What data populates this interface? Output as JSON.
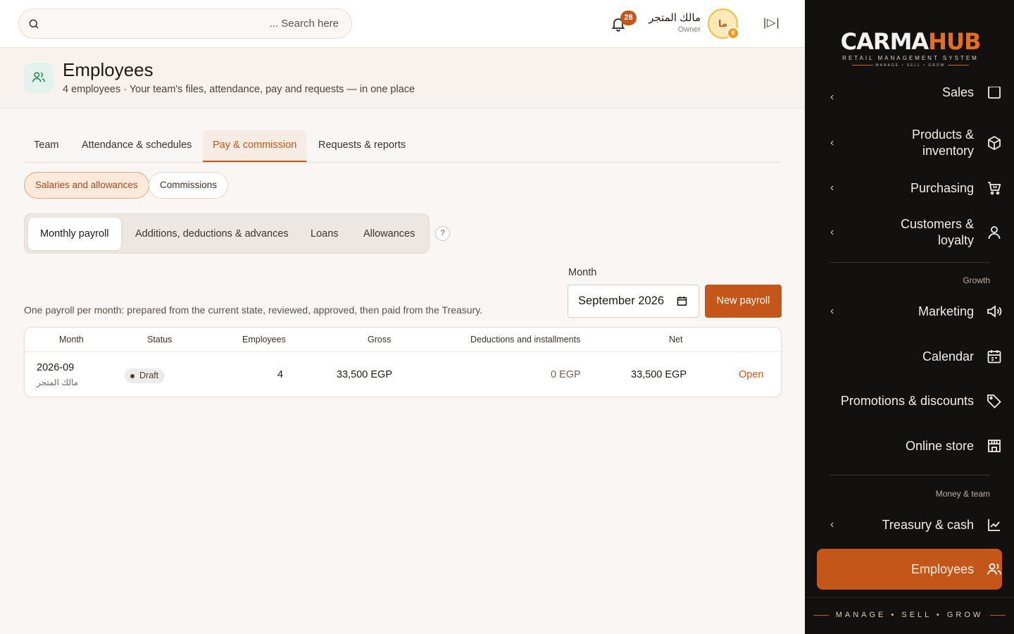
{
  "sidebar": {
    "logo": {
      "brand_a": "CARMA",
      "brand_b": "HUB",
      "tagline": "RETAIL MANAGEMENT SYSTEM",
      "sub_tagline": "MANAGE • SELL • GROW"
    },
    "partial_item": "Sales",
    "items": [
      {
        "label": "Products & inventory",
        "icon": "box-icon"
      },
      {
        "label": "Purchasing",
        "icon": "cart-icon"
      },
      {
        "label": "Customers & loyalty",
        "icon": "user-icon"
      },
      {
        "label": "Marketing",
        "icon": "megaphone-icon"
      },
      {
        "label": "Calendar",
        "icon": "calendar-icon"
      },
      {
        "label": "Promotions & discounts",
        "icon": "tag-icon"
      },
      {
        "label": "Online store",
        "icon": "store-icon"
      },
      {
        "label": "Treasury & cash",
        "icon": "chart-icon"
      },
      {
        "label": "Employees",
        "icon": "users-icon"
      }
    ],
    "sections": {
      "growth": "Growth",
      "money_team": "Money & team"
    },
    "footer": "MANAGE • SELL • GROW"
  },
  "topbar": {
    "search_placeholder": "... Search here",
    "notifications": "28",
    "user_name": "مالك المتجر",
    "user_role": "Owner",
    "avatar_initials": "ما",
    "collapse_glyph": "|▷|"
  },
  "page": {
    "title": "Employees",
    "subtitle": "4 employees · Your team's files, attendance, pay and requests — in one place"
  },
  "tabs": [
    "Team",
    "Attendance & schedules",
    "Pay & commission",
    "Requests & reports"
  ],
  "pills": [
    "Salaries and allowances",
    "Commissions"
  ],
  "segments": [
    "Monthly payroll",
    "Additions, deductions & advances",
    "Loans",
    "Allowances"
  ],
  "help": "?",
  "month": {
    "label": "Month",
    "value": "September 2026"
  },
  "new_payroll": "New payroll",
  "description": "One payroll per month: prepared from the current state, reviewed, approved, then paid from the Treasury.",
  "table": {
    "headers": [
      "Month",
      "Status",
      "Employees",
      "Gross",
      "Deductions and installments",
      "Net"
    ],
    "rows": [
      {
        "month": "2026-09",
        "store": "مالك المتجر",
        "status": "Draft",
        "employees": "4",
        "gross": "33,500 EGP",
        "deductions": "0 EGP",
        "net": "33,500 EGP",
        "action": "Open"
      }
    ]
  },
  "colors": {
    "accent": "#c4561a",
    "sidebar_bg": "#131110",
    "page_bg": "#faf6f3"
  }
}
